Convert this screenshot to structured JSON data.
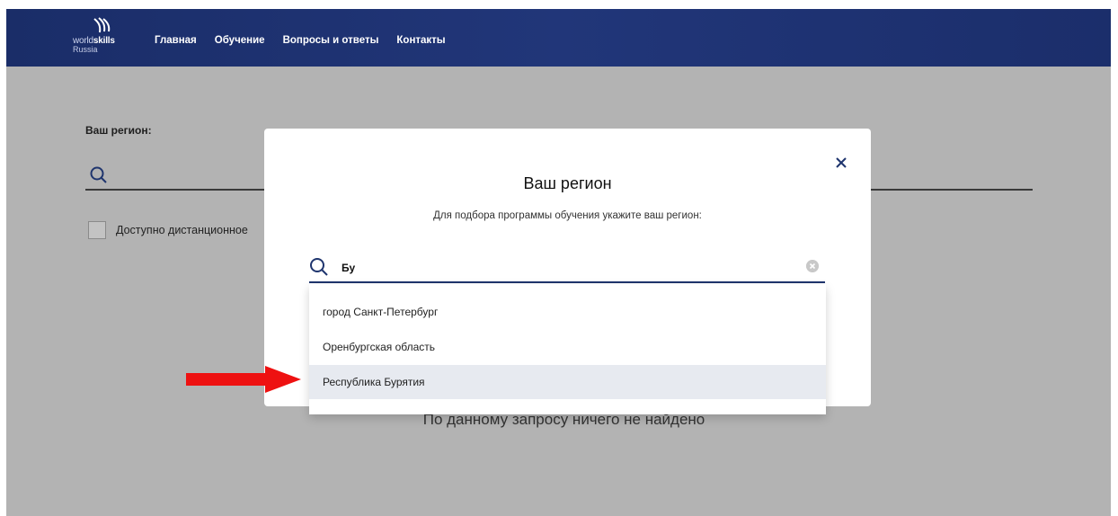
{
  "header": {
    "logo": {
      "icon": "worldskills-logo-icon",
      "word_light": "world",
      "word_bold": "skills",
      "sub": "Russia"
    },
    "nav": [
      {
        "label": "Главная"
      },
      {
        "label": "Обучение"
      },
      {
        "label": "Вопросы и ответы"
      },
      {
        "label": "Контакты"
      }
    ]
  },
  "background": {
    "region_label": "Ваш регион:",
    "distance_checkbox_label": "Доступно дистанционное",
    "empty_message": "По данному запросу ничего не найдено"
  },
  "modal": {
    "title": "Ваш регион",
    "subtitle": "Для подбора программы обучения укажите ваш регион:",
    "search": {
      "value": "Бу",
      "placeholder": ""
    },
    "close_icon": "close-icon",
    "clear_icon": "clear-icon"
  },
  "dropdown": {
    "items": [
      {
        "label": "город Санкт-Петербург",
        "highlighted": false
      },
      {
        "label": "Оренбургская область",
        "highlighted": false
      },
      {
        "label": "Республика Бурятия",
        "highlighted": true
      }
    ]
  },
  "annotation": {
    "icon": "red-arrow-icon",
    "color": "#ee1111"
  },
  "colors": {
    "header": "#1f3474",
    "accent": "#1f356e",
    "overlay": "#b3b3b3"
  }
}
